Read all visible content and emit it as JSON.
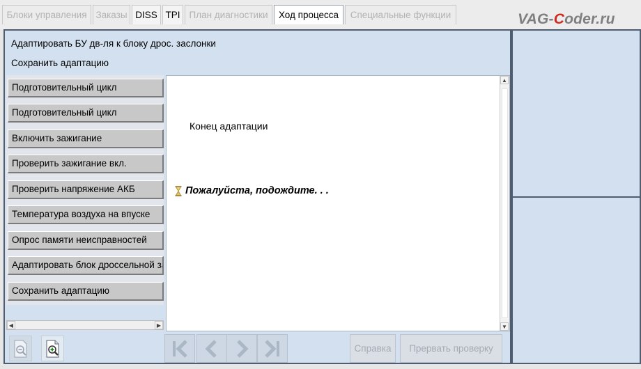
{
  "tabs": [
    {
      "label": "Блоки управления",
      "state": "disabled"
    },
    {
      "label": "Заказы",
      "state": "disabled"
    },
    {
      "label": "DISS",
      "state": "enabled"
    },
    {
      "label": "TPI",
      "state": "enabled"
    },
    {
      "label": "План диагностики",
      "state": "disabled"
    },
    {
      "label": "Ход процесса",
      "state": "active"
    },
    {
      "label": "Специальные функции",
      "state": "disabled"
    }
  ],
  "watermark": {
    "prefix": "VAG-",
    "highlight": "C",
    "suffix": "oder.ru"
  },
  "header": {
    "line1": "Адаптировать БУ дв-ля к блоку дрос. заслонки",
    "line2": "Сохранить адаптацию"
  },
  "steps": [
    "Подготовительный цикл",
    "Подготовительный цикл",
    "Включить зажигание",
    "Проверить зажигание вкл.",
    "Проверить напряжение АКБ",
    "Температура воздуха на впуске",
    "Опрос памяти неисправностей",
    "Адаптировать блок дроссельной заслонки",
    "Сохранить адаптацию"
  ],
  "content": {
    "end_text": "Конец адаптации",
    "wait_text": "Пожалуйста, подождите. . ."
  },
  "buttons": {
    "help": "Справка",
    "abort": "Прервать проверку"
  },
  "icons": {
    "zoom_out": "zoom-out-icon",
    "zoom_in": "zoom-in-icon",
    "first": "skip-to-first-icon",
    "prev": "chevron-left-icon",
    "next": "chevron-right-icon",
    "last": "skip-to-last-icon",
    "hourglass": "hourglass-icon"
  },
  "colors": {
    "frame_border": "#4e5d70",
    "panel_bg": "#d2e0ef",
    "watermark_gray": "#7f7f7f",
    "watermark_red": "#d02a1f",
    "disabled_text": "#a4abb3"
  }
}
